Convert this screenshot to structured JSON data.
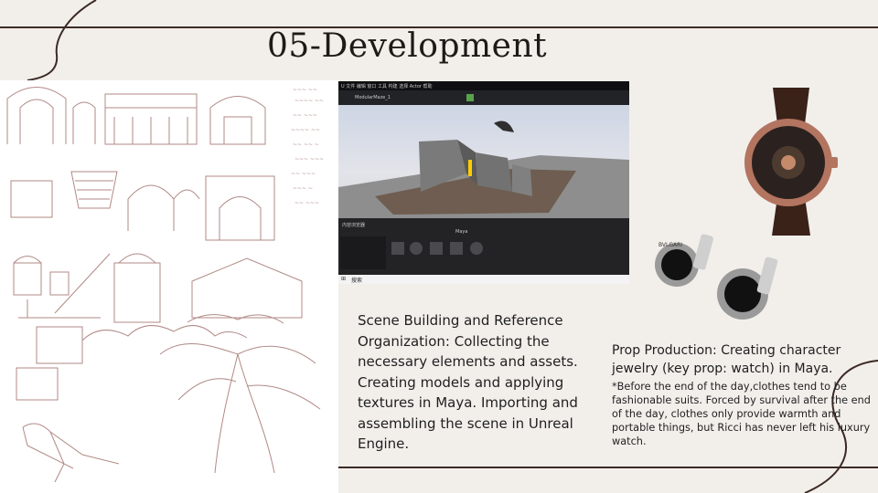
{
  "slide": {
    "title": "05-Development"
  },
  "colors": {
    "background": "#f2efeb",
    "line": "#3b2a24",
    "sketch_ink": "#b08a86"
  },
  "unreal_screenshot": {
    "project_label": "ModularMaze_1",
    "content_path": "Maya",
    "search_label": "搜索"
  },
  "scene_text": "Scene Building and Reference Organization: Collecting the necessary elements and assets. Creating models and applying textures in Maya. Importing and assembling the scene in Unreal Engine.",
  "prop_text": "Prop Production: Creating character jewelry (key prop: watch) in Maya.",
  "prop_note": "*Before the end of the day,clothes tend to be fashionable suits. Forced by survival after the end of the day, clothes only provide warmth and portable things, but Ricci has never left his luxury watch.",
  "cufflink_engraving": "BVLGARI"
}
